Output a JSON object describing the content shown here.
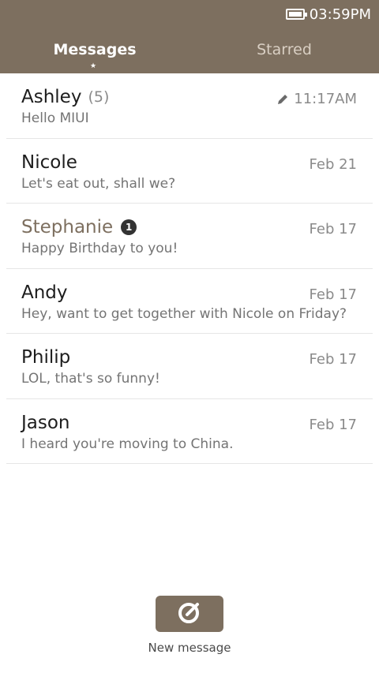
{
  "status": {
    "time": "03:59PM"
  },
  "tabs": [
    {
      "label": "Messages",
      "active": true
    },
    {
      "label": "Starred",
      "active": false
    }
  ],
  "conversations": [
    {
      "name": "Ashley",
      "count": "(5)",
      "preview": "Hello MIUI",
      "time": "11:17AM",
      "draft": true
    },
    {
      "name": "Nicole",
      "preview": "Let's eat out, shall we?",
      "time": "Feb 21"
    },
    {
      "name": "Stephanie",
      "unread": "1",
      "preview": "Happy Birthday to you!",
      "time": "Feb 17"
    },
    {
      "name": "Andy",
      "preview": "Hey, want to get together with Nicole on Friday?",
      "time": "Feb 17"
    },
    {
      "name": "Philip",
      "preview": "LOL, that's so funny!",
      "time": "Feb 17"
    },
    {
      "name": "Jason",
      "preview": "I heard you're moving to China.",
      "time": "Feb 17"
    }
  ],
  "compose": {
    "label": "New message",
    "icon": "compose-icon"
  },
  "colors": {
    "accent": "#7d6f5f"
  }
}
